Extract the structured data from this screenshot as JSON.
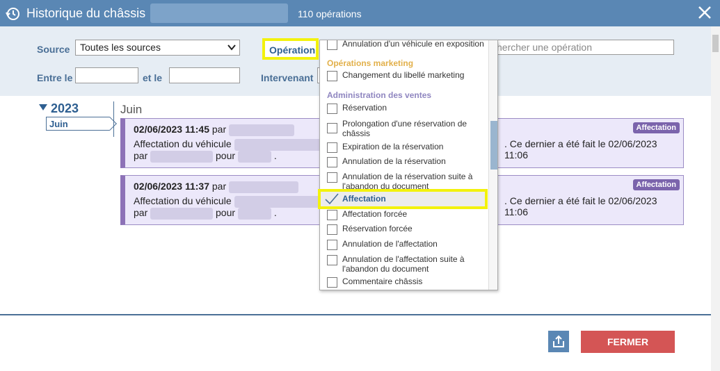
{
  "titlebar": {
    "title": "Historique du châssis",
    "count": "110 opérations",
    "icon_left": "history-icon",
    "icon_close": "close-icon"
  },
  "filters": {
    "source_label": "Source",
    "source_value": "Toutes les sources",
    "operation_label": "Opération",
    "search_placeholder": "chercher une opération",
    "between_label": "Entre le",
    "and_label": "et le",
    "intervenant_label": "Intervenant"
  },
  "timeline": {
    "year": "2023",
    "month_tab": "Juin",
    "month_title": "Juin"
  },
  "cards": [
    {
      "datetime": "02/06/2023 11:45",
      "par": "par",
      "line2_prefix": "Affectation du véhicule",
      "line2_suffix": ". Ce dernier a été fait le 02/06/2023 11:06",
      "line3_par": "par",
      "line3_pour": "pour",
      "line3_end": ".",
      "badge": "Affectation"
    },
    {
      "datetime": "02/06/2023 11:37",
      "par": "par",
      "line2_prefix": "Affectation du véhicule",
      "line2_suffix": ". Ce dernier a été fait le 02/06/2023 11:06",
      "line3_par": "par",
      "line3_pour": "pour",
      "line3_end": ".",
      "badge": "Affectation"
    }
  ],
  "dropdown": {
    "top_item": "Annulation d'un véhicule en exposition",
    "group_marketing": "Opérations marketing",
    "marketing_items": [
      "Changement du libellé marketing"
    ],
    "group_admin": "Administration des ventes",
    "admin_items": [
      "Réservation",
      "Prolongation d'une réservation de châssis",
      "Expiration de la réservation",
      "Annulation de la réservation",
      "Annulation de la réservation suite à l'abandon du document",
      "Affectation",
      "Affectation forcée",
      "Réservation forcée",
      "Annulation de l'affectation",
      "Annulation de l'affectation suite à l'abandon du document",
      "Commentaire châssis"
    ],
    "selected_item": "Affectation"
  },
  "footer": {
    "export_icon": "export-icon",
    "close_button": "FERMER"
  },
  "colors": {
    "titlebar": "#5a87b4",
    "filter_bg": "#e6edf4",
    "card_bg": "#ece8fa",
    "card_accent": "#8d72b7",
    "badge": "#7b64ac",
    "highlight": "#f3f20d",
    "close_button": "#d45555"
  }
}
